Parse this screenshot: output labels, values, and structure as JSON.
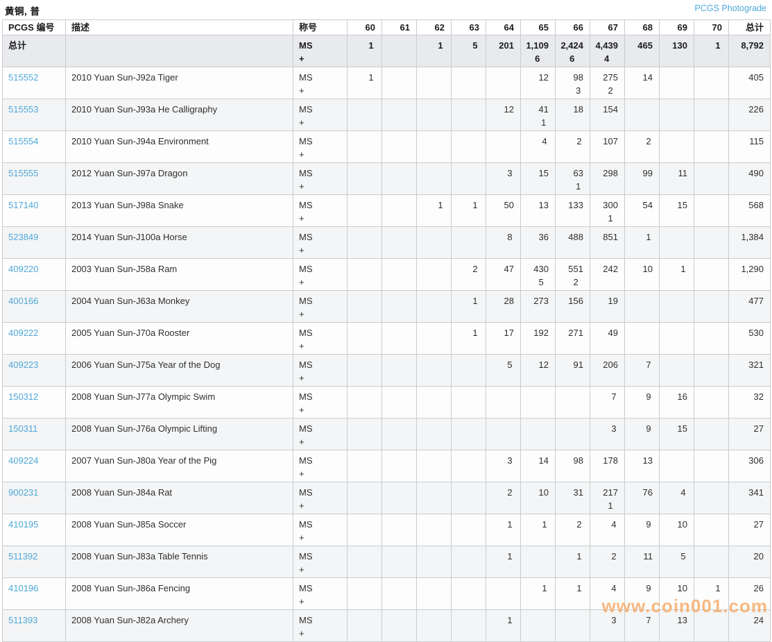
{
  "header": {
    "title": "黄铜, 普",
    "photograde_link": "PCGS Photograde"
  },
  "colors": {
    "link_blue": "#4fa8d9",
    "totals_bg": "#e8eaed",
    "watermark_orange": "#f5a55f"
  },
  "table": {
    "columns": [
      "PCGS 编号",
      "描述",
      "称号",
      "60",
      "61",
      "62",
      "63",
      "64",
      "65",
      "66",
      "67",
      "68",
      "69",
      "70",
      "总计"
    ],
    "column_keys": [
      "pcgs-number",
      "description",
      "designation",
      "60",
      "61",
      "62",
      "63",
      "64",
      "65",
      "66",
      "67",
      "68",
      "69",
      "70",
      "total"
    ],
    "grade_keys": [
      "60",
      "61",
      "62",
      "63",
      "64",
      "65",
      "66",
      "67",
      "68",
      "69",
      "70"
    ],
    "totals": {
      "label": "总计",
      "designation": [
        "MS",
        "+"
      ],
      "values": [
        "1",
        "",
        "1",
        "5",
        "201",
        "1,109",
        "2,424",
        "4,439",
        "465",
        "130",
        "1"
      ],
      "plus": [
        "",
        "",
        "",
        "",
        "",
        "6",
        "6",
        "4",
        "",
        "",
        ""
      ],
      "total": "8,792"
    },
    "rows": [
      {
        "id": "515552",
        "desc": "2010 Yuan Sun-J92a Tiger",
        "designation": [
          "MS",
          "+"
        ],
        "values": [
          "1",
          "",
          "",
          "",
          "",
          "12",
          "98",
          "275",
          "14",
          "",
          ""
        ],
        "plus": [
          "",
          "",
          "",
          "",
          "",
          "",
          "3",
          "2",
          "",
          "",
          ""
        ],
        "total": "405"
      },
      {
        "id": "515553",
        "desc": "2010 Yuan Sun-J93a He Calligraphy",
        "designation": [
          "MS",
          "+"
        ],
        "values": [
          "",
          "",
          "",
          "",
          "12",
          "41",
          "18",
          "154",
          "",
          "",
          ""
        ],
        "plus": [
          "",
          "",
          "",
          "",
          "",
          "1",
          "",
          "",
          "",
          "",
          ""
        ],
        "total": "226"
      },
      {
        "id": "515554",
        "desc": "2010 Yuan Sun-J94a Environment",
        "designation": [
          "MS",
          "+"
        ],
        "values": [
          "",
          "",
          "",
          "",
          "",
          "4",
          "2",
          "107",
          "2",
          "",
          ""
        ],
        "plus": [
          "",
          "",
          "",
          "",
          "",
          "",
          "",
          "",
          "",
          "",
          ""
        ],
        "total": "115"
      },
      {
        "id": "515555",
        "desc": "2012 Yuan Sun-J97a Dragon",
        "designation": [
          "MS",
          "+"
        ],
        "values": [
          "",
          "",
          "",
          "",
          "3",
          "15",
          "63",
          "298",
          "99",
          "11",
          ""
        ],
        "plus": [
          "",
          "",
          "",
          "",
          "",
          "",
          "1",
          "",
          "",
          "",
          ""
        ],
        "total": "490"
      },
      {
        "id": "517140",
        "desc": "2013 Yuan Sun-J98a Snake",
        "designation": [
          "MS",
          "+"
        ],
        "values": [
          "",
          "",
          "1",
          "1",
          "50",
          "13",
          "133",
          "300",
          "54",
          "15",
          ""
        ],
        "plus": [
          "",
          "",
          "",
          "",
          "",
          "",
          "",
          "1",
          "",
          "",
          ""
        ],
        "total": "568"
      },
      {
        "id": "523849",
        "desc": "2014 Yuan Sun-J100a Horse",
        "designation": [
          "MS",
          "+"
        ],
        "values": [
          "",
          "",
          "",
          "",
          "8",
          "36",
          "488",
          "851",
          "1",
          "",
          ""
        ],
        "plus": [
          "",
          "",
          "",
          "",
          "",
          "",
          "",
          "",
          "",
          "",
          ""
        ],
        "total": "1,384"
      },
      {
        "id": "409220",
        "desc": "2003 Yuan Sun-J58a Ram",
        "designation": [
          "MS",
          "+"
        ],
        "values": [
          "",
          "",
          "",
          "2",
          "47",
          "430",
          "551",
          "242",
          "10",
          "1",
          ""
        ],
        "plus": [
          "",
          "",
          "",
          "",
          "",
          "5",
          "2",
          "",
          "",
          "",
          ""
        ],
        "total": "1,290"
      },
      {
        "id": "400166",
        "desc": "2004 Yuan Sun-J63a Monkey",
        "designation": [
          "MS",
          "+"
        ],
        "values": [
          "",
          "",
          "",
          "1",
          "28",
          "273",
          "156",
          "19",
          "",
          "",
          ""
        ],
        "plus": [
          "",
          "",
          "",
          "",
          "",
          "",
          "",
          "",
          "",
          "",
          ""
        ],
        "total": "477"
      },
      {
        "id": "409222",
        "desc": "2005 Yuan Sun-J70a Rooster",
        "designation": [
          "MS",
          "+"
        ],
        "values": [
          "",
          "",
          "",
          "1",
          "17",
          "192",
          "271",
          "49",
          "",
          "",
          ""
        ],
        "plus": [
          "",
          "",
          "",
          "",
          "",
          "",
          "",
          "",
          "",
          "",
          ""
        ],
        "total": "530"
      },
      {
        "id": "409223",
        "desc": "2006 Yuan Sun-J75a Year of the Dog",
        "designation": [
          "MS",
          "+"
        ],
        "values": [
          "",
          "",
          "",
          "",
          "5",
          "12",
          "91",
          "206",
          "7",
          "",
          ""
        ],
        "plus": [
          "",
          "",
          "",
          "",
          "",
          "",
          "",
          "",
          "",
          "",
          ""
        ],
        "total": "321"
      },
      {
        "id": "150312",
        "desc": "2008 Yuan Sun-J77a Olympic Swim",
        "designation": [
          "MS",
          "+"
        ],
        "values": [
          "",
          "",
          "",
          "",
          "",
          "",
          "",
          "7",
          "9",
          "16",
          ""
        ],
        "plus": [
          "",
          "",
          "",
          "",
          "",
          "",
          "",
          "",
          "",
          "",
          ""
        ],
        "total": "32"
      },
      {
        "id": "150311",
        "desc": "2008 Yuan Sun-J76a Olympic Lifting",
        "designation": [
          "MS",
          "+"
        ],
        "values": [
          "",
          "",
          "",
          "",
          "",
          "",
          "",
          "3",
          "9",
          "15",
          ""
        ],
        "plus": [
          "",
          "",
          "",
          "",
          "",
          "",
          "",
          "",
          "",
          "",
          ""
        ],
        "total": "27"
      },
      {
        "id": "409224",
        "desc": "2007 Yuan Sun-J80a Year of the Pig",
        "designation": [
          "MS",
          "+"
        ],
        "values": [
          "",
          "",
          "",
          "",
          "3",
          "14",
          "98",
          "178",
          "13",
          "",
          ""
        ],
        "plus": [
          "",
          "",
          "",
          "",
          "",
          "",
          "",
          "",
          "",
          "",
          ""
        ],
        "total": "306"
      },
      {
        "id": "900231",
        "desc": "2008 Yuan Sun-J84a Rat",
        "designation": [
          "MS",
          "+"
        ],
        "values": [
          "",
          "",
          "",
          "",
          "2",
          "10",
          "31",
          "217",
          "76",
          "4",
          ""
        ],
        "plus": [
          "",
          "",
          "",
          "",
          "",
          "",
          "",
          "1",
          "",
          "",
          ""
        ],
        "total": "341"
      },
      {
        "id": "410195",
        "desc": "2008 Yuan Sun-J85a Soccer",
        "designation": [
          "MS",
          "+"
        ],
        "values": [
          "",
          "",
          "",
          "",
          "1",
          "1",
          "2",
          "4",
          "9",
          "10",
          ""
        ],
        "plus": [
          "",
          "",
          "",
          "",
          "",
          "",
          "",
          "",
          "",
          "",
          ""
        ],
        "total": "27"
      },
      {
        "id": "511392",
        "desc": "2008 Yuan Sun-J83a Table Tennis",
        "designation": [
          "MS",
          "+"
        ],
        "values": [
          "",
          "",
          "",
          "",
          "1",
          "",
          "1",
          "2",
          "11",
          "5",
          ""
        ],
        "plus": [
          "",
          "",
          "",
          "",
          "",
          "",
          "",
          "",
          "",
          "",
          ""
        ],
        "total": "20"
      },
      {
        "id": "410196",
        "desc": "2008 Yuan Sun-J86a Fencing",
        "designation": [
          "MS",
          "+"
        ],
        "values": [
          "",
          "",
          "",
          "",
          "",
          "1",
          "1",
          "4",
          "9",
          "10",
          "1"
        ],
        "plus": [
          "",
          "",
          "",
          "",
          "",
          "",
          "",
          "",
          "",
          "",
          ""
        ],
        "total": "26"
      },
      {
        "id": "511393",
        "desc": "2008 Yuan Sun-J82a Archery",
        "designation": [
          "MS",
          "+"
        ],
        "values": [
          "",
          "",
          "",
          "",
          "1",
          "",
          "",
          "3",
          "7",
          "13",
          ""
        ],
        "plus": [
          "",
          "",
          "",
          "",
          "",
          "",
          "",
          "",
          "",
          "",
          ""
        ],
        "total": "24"
      }
    ]
  },
  "watermark": "www.coin001.com"
}
